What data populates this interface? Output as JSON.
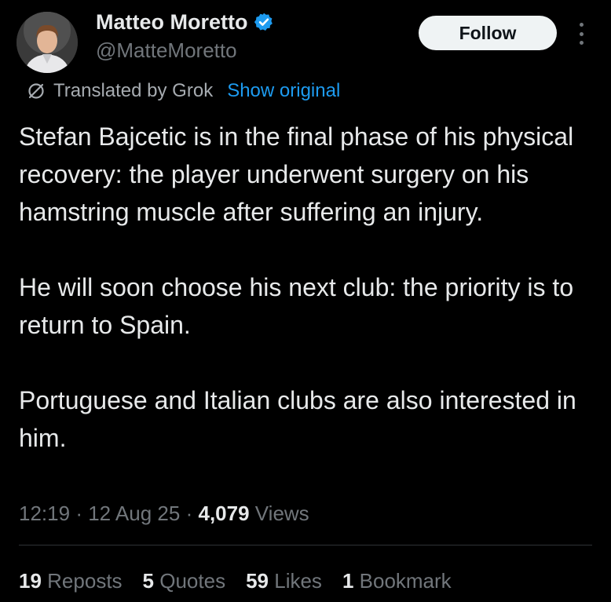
{
  "author": {
    "display_name": "Matteo Moretto",
    "handle": "@MatteMoretto",
    "verified_color": "#1d9bf0"
  },
  "follow_label": "Follow",
  "translation": {
    "label": "Translated by Grok",
    "show_original": "Show original"
  },
  "tweet": {
    "paragraphs": [
      "Stefan Bajcetic is in the final phase of his physical recovery: the player underwent surgery on his hamstring muscle after suffering an injury.",
      "He will soon choose his next club: the priority is to return to Spain.",
      "Portuguese and Italian clubs are also interested in him."
    ]
  },
  "meta": {
    "time": "12:19",
    "separator": "·",
    "date": "12 Aug 25",
    "views_count": "4,079",
    "views_label": "Views"
  },
  "stats": {
    "reposts": {
      "count": "19",
      "label": "Reposts"
    },
    "quotes": {
      "count": "5",
      "label": "Quotes"
    },
    "likes": {
      "count": "59",
      "label": "Likes"
    },
    "bookmarks": {
      "count": "1",
      "label": "Bookmark"
    }
  },
  "colors": {
    "background": "#000000",
    "text": "#e7e9ea",
    "secondary_text": "#71767b",
    "link": "#1d9bf0"
  }
}
